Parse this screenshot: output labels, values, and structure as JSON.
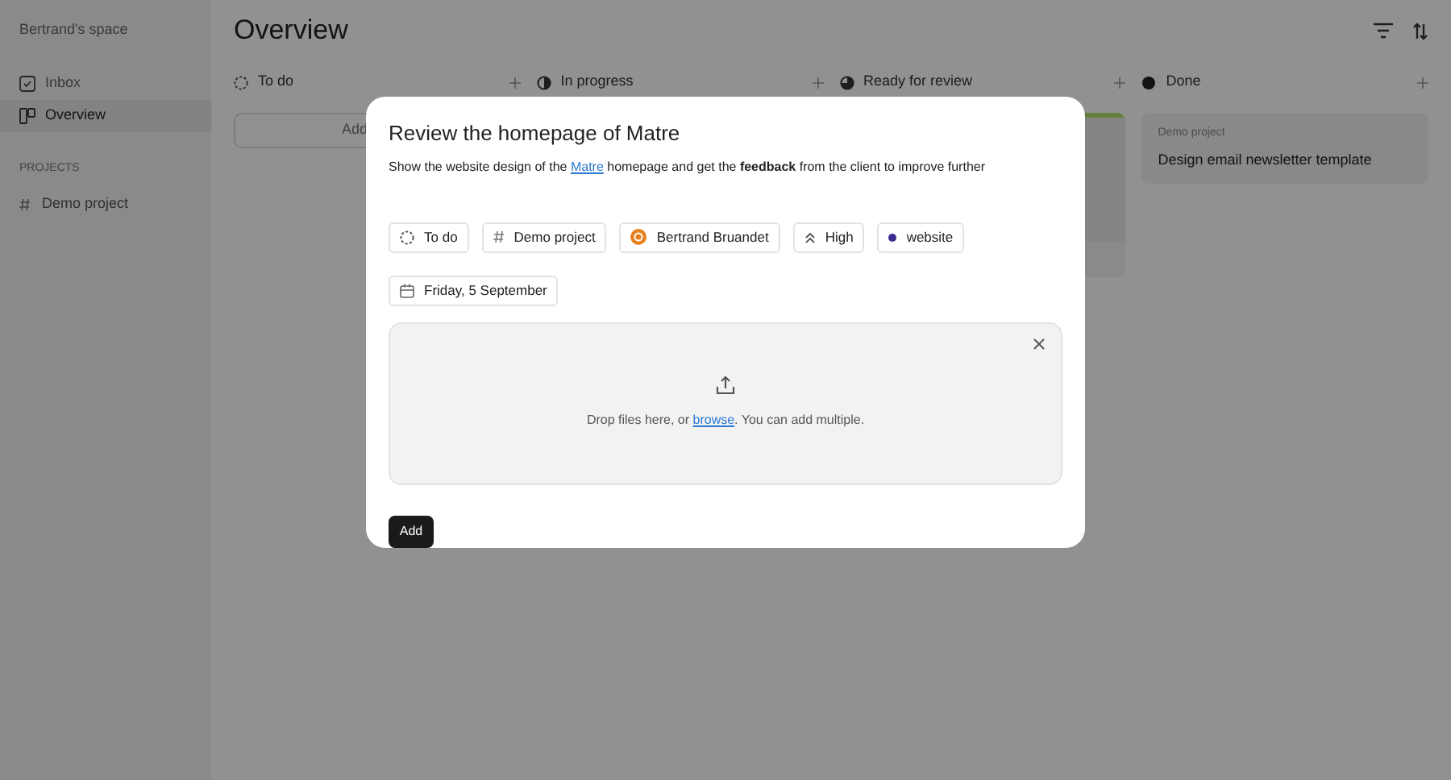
{
  "sidebar": {
    "workspace": "Bertrand's space",
    "items": [
      {
        "label": "Inbox",
        "kind": "inbox",
        "selected": false
      },
      {
        "label": "Overview",
        "kind": "board",
        "selected": true
      }
    ],
    "section": "PROJECTS",
    "projects": [
      {
        "label": "Demo project"
      }
    ]
  },
  "header": {
    "title": "Overview"
  },
  "columns": [
    {
      "name": "To do",
      "kind": "todo",
      "add_label": "Add"
    },
    {
      "name": "In progress",
      "kind": "progress"
    },
    {
      "name": "Ready for review",
      "kind": "review",
      "cards": [
        {
          "kind": "image"
        }
      ]
    },
    {
      "name": "Done",
      "kind": "done",
      "cards": [
        {
          "kind": "text",
          "project": "Demo project",
          "title": "Design email newsletter template"
        }
      ]
    }
  ],
  "modal": {
    "title": "Review the homepage of Matre",
    "description": {
      "before": "Show the website design of the",
      "link": "Matre",
      "after": "homepage and get the **feedback** from the client to improve further"
    },
    "chips": [
      {
        "kind": "status",
        "label": "To do"
      },
      {
        "kind": "project",
        "label": "Demo project"
      },
      {
        "kind": "assignee",
        "label": "Bertrand Bruandet"
      },
      {
        "kind": "priority",
        "label": "High"
      },
      {
        "kind": "tag",
        "label": "website",
        "color": "#3b2a8f"
      },
      {
        "kind": "date",
        "label": "Friday, 5 September"
      }
    ],
    "dropzone": {
      "before": "Drop files here, or",
      "link": "browse",
      "after": ". You can add multiple."
    },
    "button": "Add"
  }
}
